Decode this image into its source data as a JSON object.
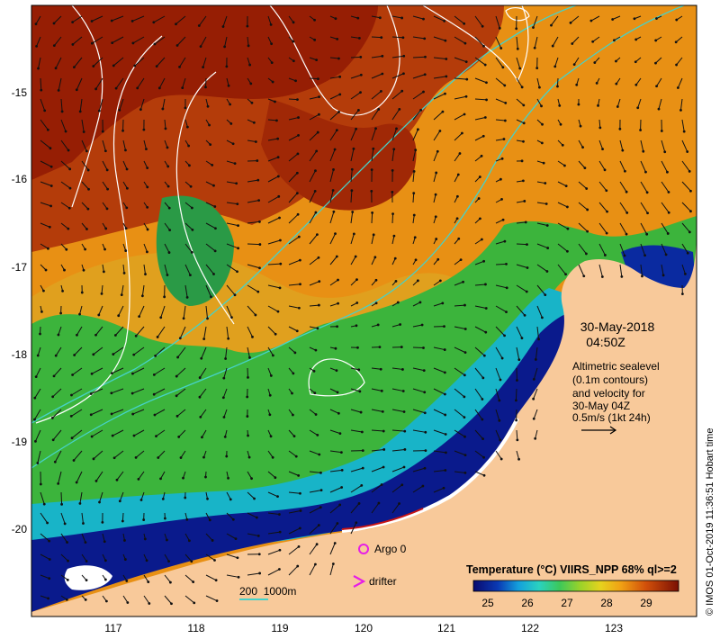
{
  "map": {
    "date": "30-May-2018",
    "time": "04:50Z",
    "info_lines": [
      "Altimetric sealevel",
      "(0.1m contours)",
      "and velocity for",
      "30-May 04Z",
      "0.5m/s (1kt 24h)"
    ],
    "lon_ticks": [
      "117",
      "118",
      "119",
      "120",
      "121",
      "122",
      "123"
    ],
    "lat_ticks": [
      "-15",
      "-16",
      "-17",
      "-18",
      "-19",
      "-20"
    ],
    "legend": {
      "argo_label": "Argo 0",
      "drifter_label": "drifter",
      "isobath_label": "200  1000m"
    },
    "colorbar": {
      "title": "Temperature (°C) VIIRS_NPP 68% ql>=2",
      "ticks": [
        "25",
        "26",
        "27",
        "28",
        "29"
      ]
    },
    "credit": "© IMOS 01-Oct-2019 11:36:51 Hobart time",
    "colors": {
      "land": "#f8c99a",
      "cold": "#0a1a8c",
      "warm": "#8c1a05",
      "isobath": "#46d2c8"
    }
  }
}
